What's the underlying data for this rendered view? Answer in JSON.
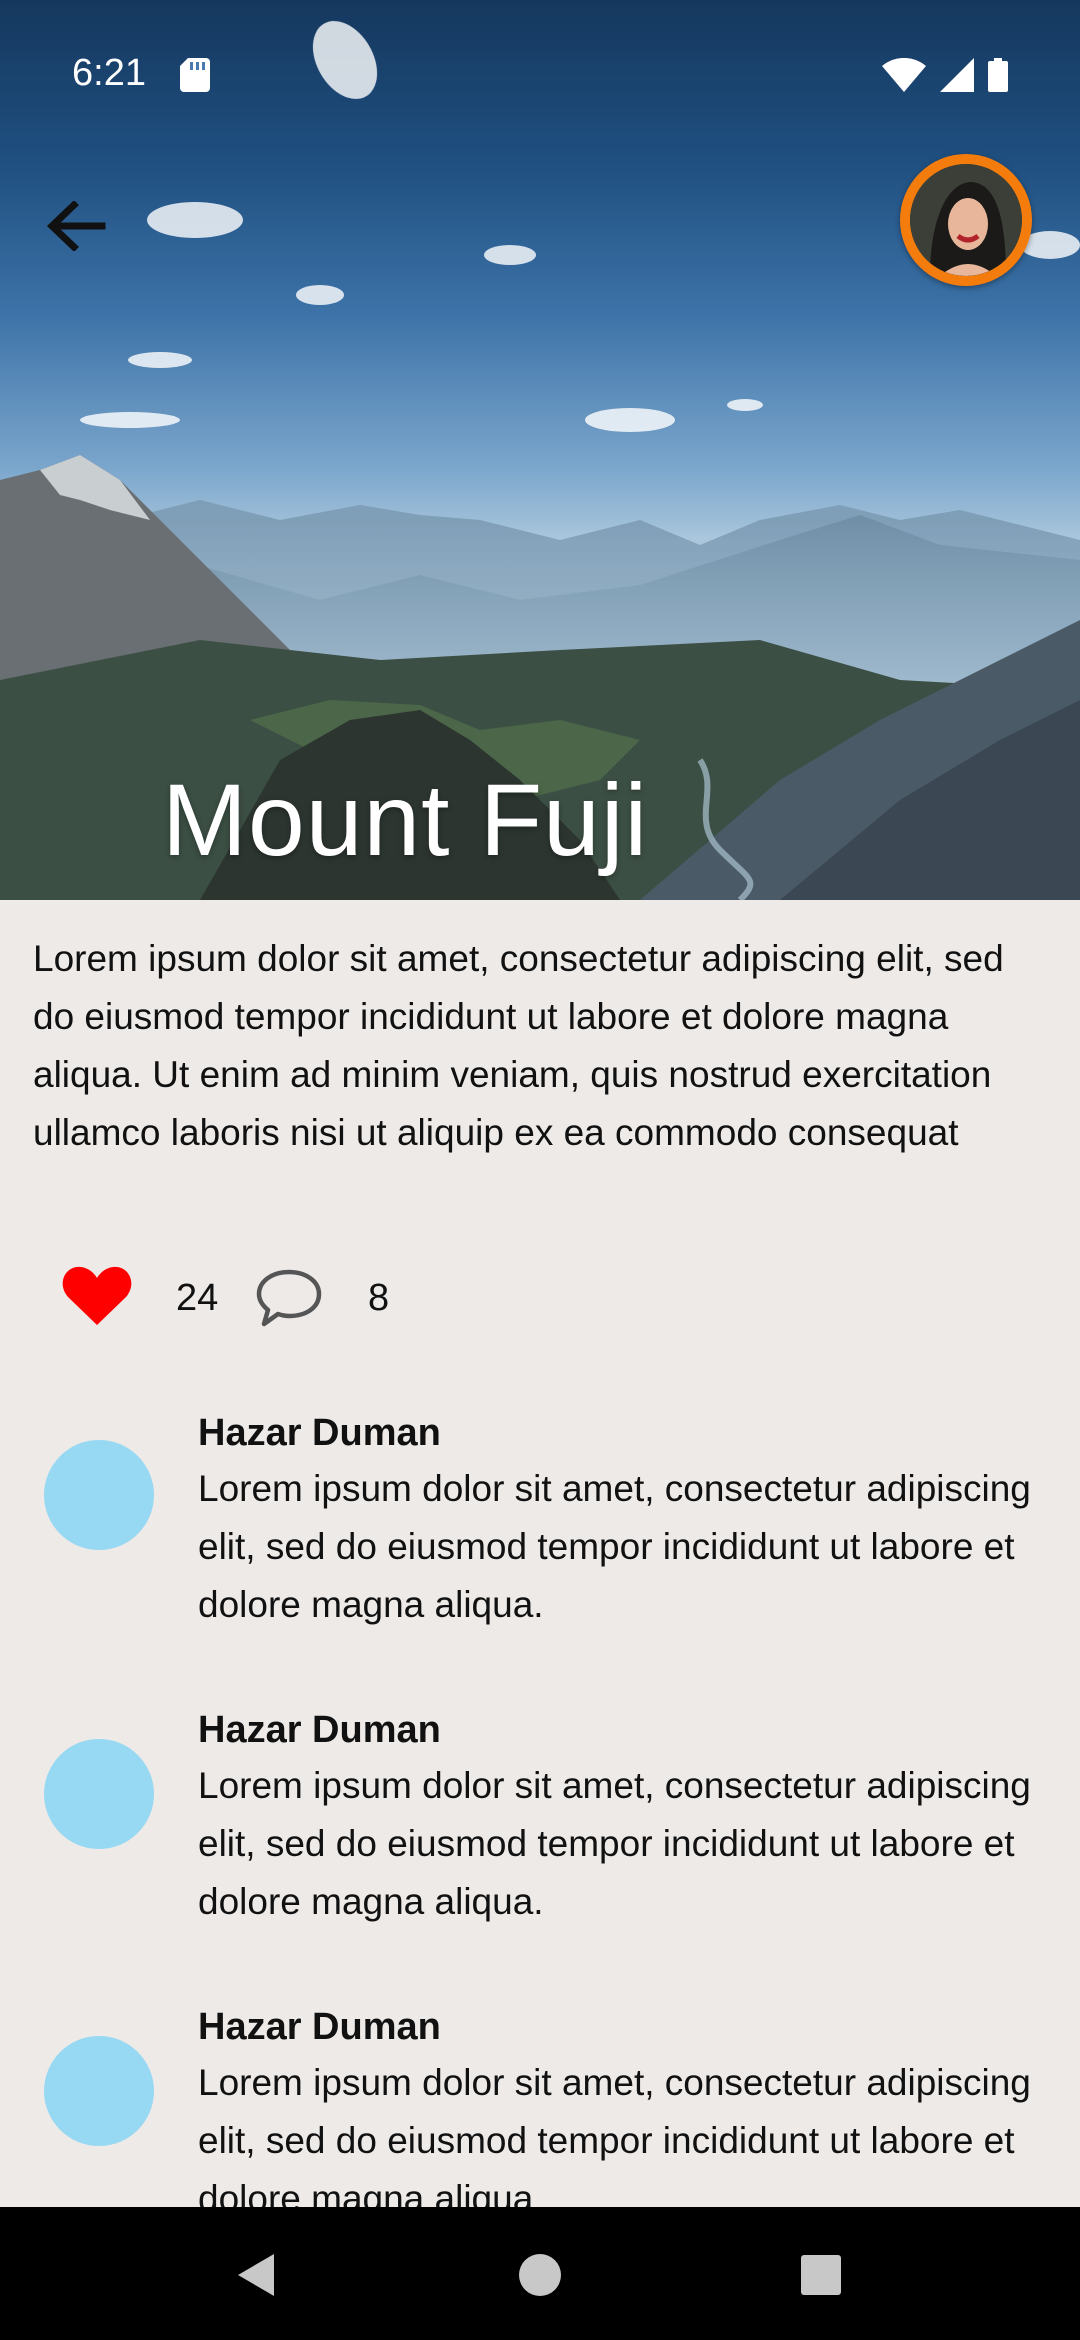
{
  "status_bar": {
    "time": "6:21"
  },
  "post": {
    "title": "Mount Fuji",
    "description": "Lorem ipsum dolor sit amet, consectetur adipiscing elit, sed do eiusmod tempor incididunt ut labore et dolore magna aliqua. Ut enim ad minim veniam, quis nostrud exercitation ullamco laboris nisi ut aliquip ex ea commodo consequat",
    "likes": "24",
    "comments_count": "8"
  },
  "comments": [
    {
      "author": "Hazar Duman",
      "text": "Lorem ipsum dolor sit amet, consectetur adipiscing elit, sed do eiusmod tempor incididunt ut labore et dolore magna aliqua."
    },
    {
      "author": "Hazar Duman",
      "text": "Lorem ipsum dolor sit amet, consectetur adipiscing elit, sed do eiusmod tempor incididunt ut labore et dolore magna aliqua."
    },
    {
      "author": "Hazar Duman",
      "text": "Lorem ipsum dolor sit amet, consectetur adipiscing elit, sed do eiusmod tempor incididunt ut labore et dolore magna aliqua."
    }
  ],
  "icons": {
    "back": "arrow-left-icon",
    "like": "heart-icon",
    "comment": "speech-bubble-icon",
    "sd_card": "sd-card-icon",
    "wifi": "wifi-icon",
    "signal": "signal-icon",
    "battery": "battery-icon",
    "nav_back": "triangle-back-icon",
    "nav_home": "circle-home-icon",
    "nav_recents": "square-recents-icon"
  },
  "colors": {
    "background": "#edeae8",
    "like": "#ff0000",
    "avatar_ring": "#f47c0d",
    "comment_avatar": "#97d8f2",
    "nav_bar": "#000000"
  }
}
